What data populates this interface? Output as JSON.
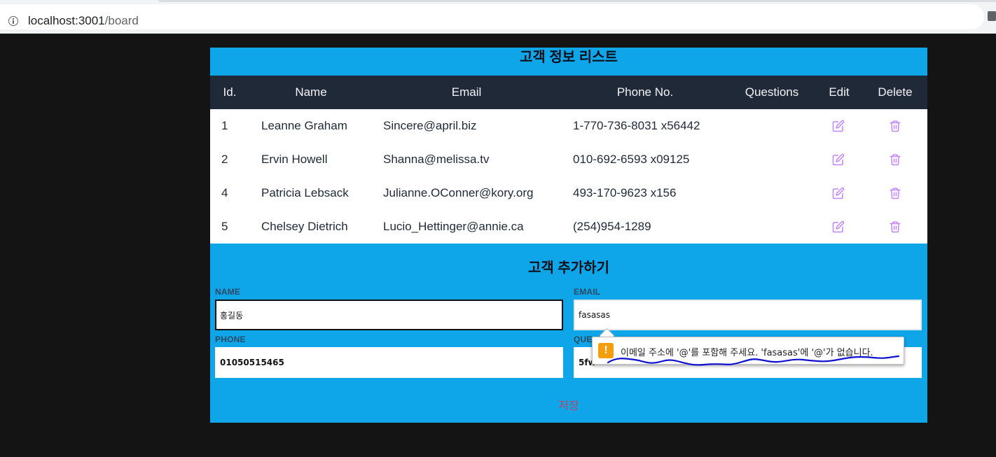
{
  "browser": {
    "url_host": "localhost:3001",
    "url_path": "/board"
  },
  "list": {
    "title": "고객 정보 리스트",
    "headers": {
      "id": "Id.",
      "name": "Name",
      "email": "Email",
      "phone": "Phone No.",
      "questions": "Questions",
      "edit": "Edit",
      "delete": "Delete"
    },
    "rows": [
      {
        "id": "1",
        "name": "Leanne Graham",
        "email": "Sincere@april.biz",
        "phone": "1-770-736-8031 x56442",
        "questions": ""
      },
      {
        "id": "2",
        "name": "Ervin Howell",
        "email": "Shanna@melissa.tv",
        "phone": "010-692-6593 x09125",
        "questions": ""
      },
      {
        "id": "4",
        "name": "Patricia Lebsack",
        "email": "Julianne.OConner@kory.org",
        "phone": "493-170-9623 x156",
        "questions": ""
      },
      {
        "id": "5",
        "name": "Chelsey Dietrich",
        "email": "Lucio_Hettinger@annie.ca",
        "phone": "(254)954-1289",
        "questions": ""
      }
    ],
    "icons": {
      "edit": "edit-icon",
      "delete": "trash-icon"
    }
  },
  "form": {
    "title": "고객 추가하기",
    "name_label": "NAME",
    "name_value": "홍길동",
    "email_label": "EMAIL",
    "email_value": "fasasas",
    "phone_label": "PHONE",
    "phone_value": "01050515465",
    "questions_label": "QUE",
    "questions_value": "5fw",
    "save_label": "저장"
  },
  "validation": {
    "message": "이메일 주소에 '@'를 포함해 주세요. 'fasasas'에 '@'가 없습니다.",
    "icon": "warning-icon"
  },
  "colors": {
    "panel": "#0ea5e9",
    "header": "#1f2937",
    "action_icons": "#c084fc",
    "save_text": "#b34a6a"
  }
}
